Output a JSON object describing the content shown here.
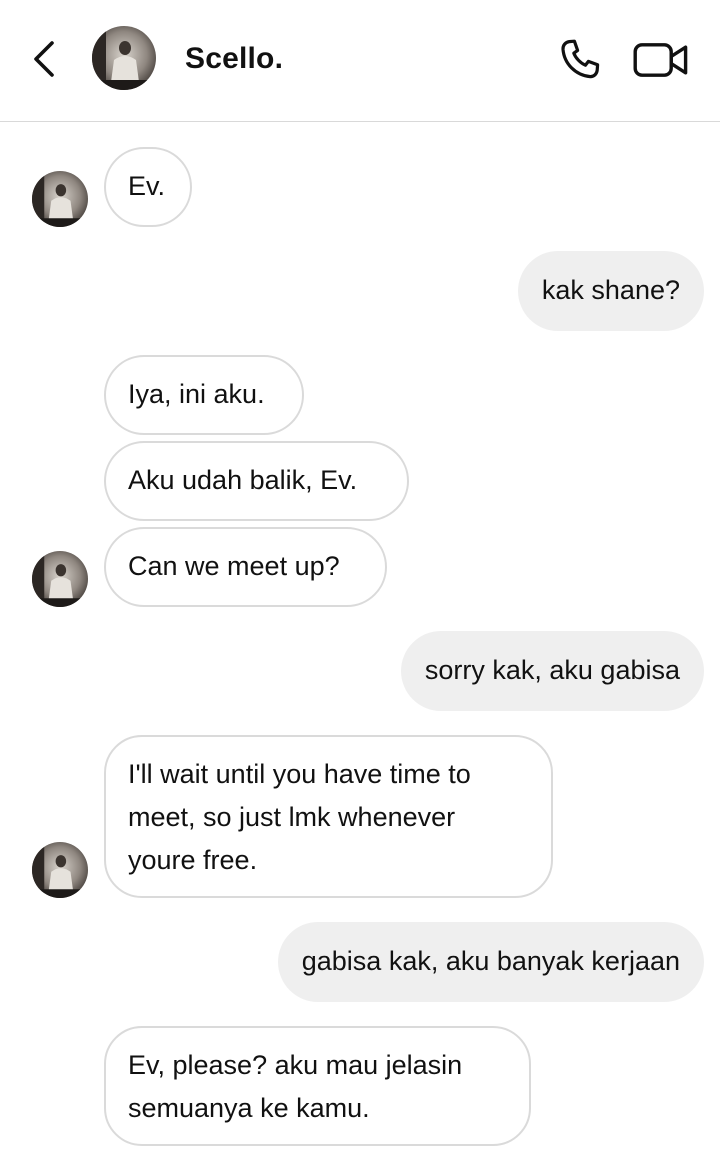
{
  "header": {
    "contact_name": "Scello.",
    "icons": [
      "chevron-left-icon",
      "phone-icon",
      "video-camera-icon"
    ]
  },
  "messages": [
    {
      "from": "them",
      "text": "Ev."
    },
    {
      "from": "me",
      "text": "kak shane?"
    },
    {
      "from": "them",
      "text": "Iya, ini aku."
    },
    {
      "from": "them",
      "text": "Aku udah balik, Ev."
    },
    {
      "from": "them",
      "text": "Can we meet up?"
    },
    {
      "from": "me",
      "text": "sorry kak, aku gabisa"
    },
    {
      "from": "them",
      "text": "I'll wait until you have time to meet, so just lmk whenever youre free."
    },
    {
      "from": "me",
      "text": "gabisa kak, aku banyak kerjaan"
    },
    {
      "from": "them",
      "text": "Ev, please? aku mau jelasin semuanya ke kamu."
    }
  ],
  "colors": {
    "incoming_border": "#dadada",
    "outgoing_bg": "#efefef",
    "text": "#111111"
  }
}
